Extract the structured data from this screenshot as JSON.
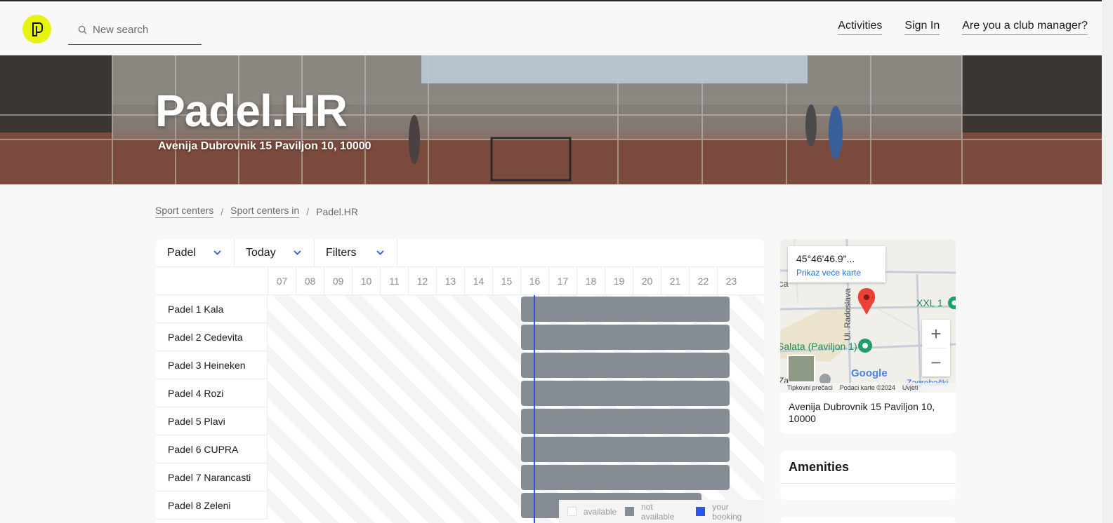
{
  "header": {
    "search_placeholder": "New search",
    "nav": [
      "Activities",
      "Sign In",
      "Are you a club manager?"
    ]
  },
  "hero": {
    "title": "Padel.HR",
    "address": "Avenija Dubrovnik 15 Paviljon 10, 10000"
  },
  "breadcrumb": [
    "Sport centers",
    "Sport centers in",
    "Padel.HR"
  ],
  "schedule": {
    "filters": [
      "Padel",
      "Today",
      "Filters"
    ],
    "hours": [
      "07",
      "08",
      "09",
      "10",
      "11",
      "12",
      "13",
      "14",
      "15",
      "16",
      "17",
      "18",
      "19",
      "20",
      "21",
      "22",
      "23"
    ],
    "courts": [
      {
        "name": "Padel 1 Kala",
        "not_available": [
          "16:00",
          "23:30"
        ]
      },
      {
        "name": "Padel 2 Cedevita",
        "not_available": [
          "16:00",
          "23:30"
        ]
      },
      {
        "name": "Padel 3 Heineken",
        "not_available": [
          "16:00",
          "23:30"
        ]
      },
      {
        "name": "Padel 4 Rozi",
        "not_available": [
          "16:00",
          "23:30"
        ]
      },
      {
        "name": "Padel 5 Plavi",
        "not_available": [
          "16:00",
          "23:30"
        ]
      },
      {
        "name": "Padel 6 CUPRA",
        "not_available": [
          "16:00",
          "23:30"
        ]
      },
      {
        "name": "Padel 7 Narancasti",
        "not_available": [
          "16:00",
          "23:30"
        ]
      },
      {
        "name": "Padel 8 Zeleni",
        "not_available": [
          "16:00",
          "22:30"
        ]
      }
    ],
    "legend": [
      {
        "label": "available",
        "color": "#ffffff"
      },
      {
        "label": "not available",
        "color": "#868c93"
      },
      {
        "label": "your booking",
        "color": "#2b55e6"
      }
    ]
  },
  "map": {
    "coord": "45°46'46.9\"...",
    "link": "Prikaz veće karte",
    "street_label": "Ul. Radoslava",
    "poi_xxl": "XXL 1",
    "poi_salata": "Salata (Paviljon 1)",
    "poi_zagreb": "Zagrebački",
    "edge_ca": "ca",
    "edge_za": "Za",
    "google": "Google",
    "footer": [
      "Tipkovni prečaci",
      "Podaci karte ©2024",
      "Uvjeti"
    ],
    "address": "Avenija Dubrovnik 15 Paviljon 10, 10000"
  },
  "amenities": {
    "title": "Amenities"
  },
  "colors": {
    "accent": "#3354d9",
    "logo": "#e6f410",
    "booked": "#868c93"
  }
}
